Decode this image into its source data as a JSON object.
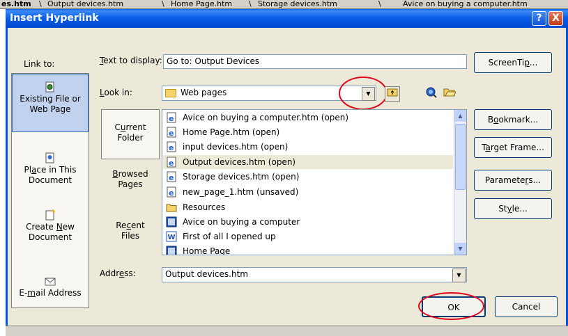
{
  "tabs": {
    "partial": "es.htm",
    "items": [
      "Output devices.htm",
      "Home Page.htm",
      "Storage devices.htm",
      "Avice on buying a computer.htm"
    ]
  },
  "dialog": {
    "title": "Insert Hyperlink",
    "help_glyph": "?",
    "close_glyph": "X"
  },
  "link_to": {
    "label": "Link to:",
    "items": [
      {
        "label_1": "Existing File or",
        "label_2": "Web Page",
        "icon": "document-globe-icon",
        "selected": true
      },
      {
        "label_1": "Place in This",
        "label_2": "Document",
        "icon": "place-in-document-icon"
      },
      {
        "label_1": "Create New",
        "label_2": "Document",
        "icon": "new-document-icon"
      },
      {
        "label_1": "E-mail Address",
        "label_2": "",
        "icon": "envelope-icon"
      }
    ]
  },
  "text_to_display": {
    "label": "Text to display:",
    "value": "Go to: Output Devices"
  },
  "look_in": {
    "label": "Look in:",
    "value": "Web pages"
  },
  "browse": {
    "current_1": "Current",
    "current_2": "Folder",
    "browsed_1": "Browsed",
    "browsed_2": "Pages",
    "recent_1": "Recent",
    "recent_2": "Files"
  },
  "files": [
    {
      "name": "Avice on buying a computer.htm (open)",
      "icon": "ie-page-icon"
    },
    {
      "name": "Home Page.htm (open)",
      "icon": "ie-page-icon"
    },
    {
      "name": "input devices.htm (open)",
      "icon": "ie-page-icon"
    },
    {
      "name": "Output devices.htm (open)",
      "icon": "ie-page-icon",
      "selected": true
    },
    {
      "name": "Storage devices.htm (open)",
      "icon": "ie-page-icon"
    },
    {
      "name": "new_page_1.htm (unsaved)",
      "icon": "ie-page-icon"
    },
    {
      "name": "Resources",
      "icon": "folder-icon"
    },
    {
      "name": "Avice on buying a computer",
      "icon": "publisher-doc-icon"
    },
    {
      "name": "First of all I opened up",
      "icon": "word-doc-icon"
    },
    {
      "name": "Home Page",
      "icon": "publisher-doc-icon"
    }
  ],
  "address": {
    "label": "Address:",
    "value": "Output devices.htm"
  },
  "buttons": {
    "screentip": "ScreenTip...",
    "bookmark": "Bookmark...",
    "target_frame": "Target Frame...",
    "parameters": "Parameters...",
    "style": "Style...",
    "ok": "OK",
    "cancel": "Cancel"
  },
  "colors": {
    "titlebar": "#0a5fe8",
    "dialog_bg": "#ece9d8",
    "annotation": "#e0001a"
  }
}
